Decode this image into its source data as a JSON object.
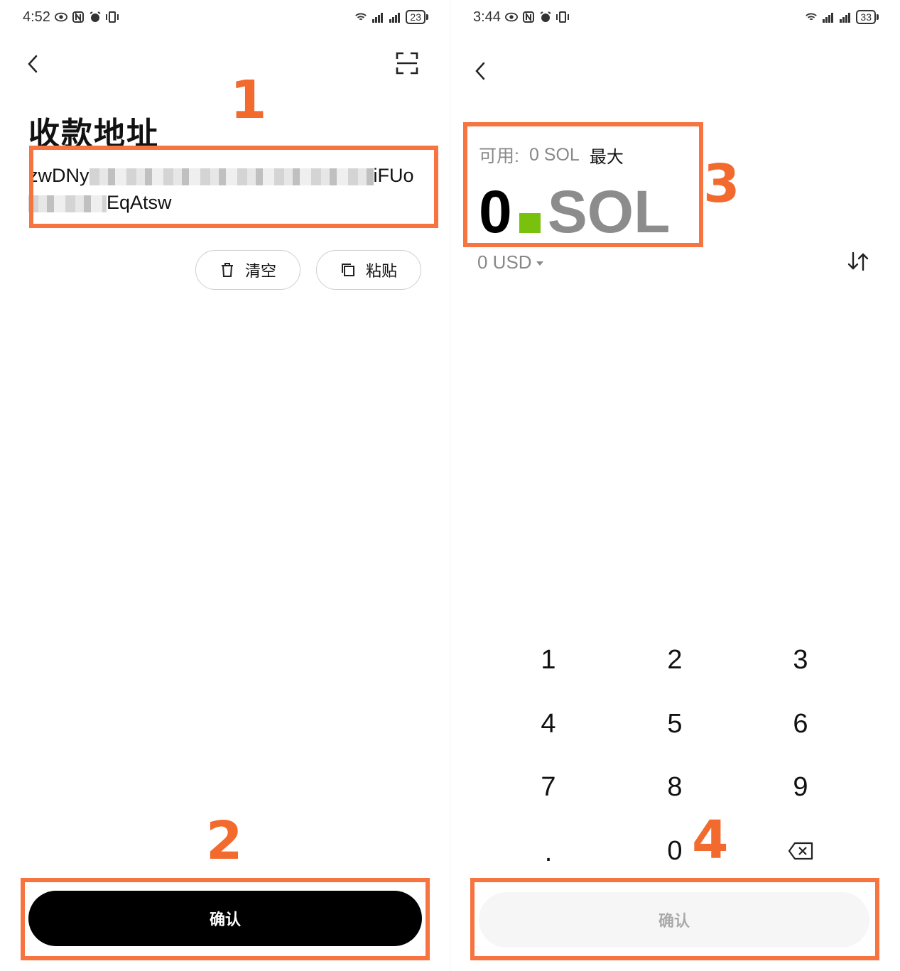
{
  "left": {
    "status": {
      "time": "4:52",
      "battery": "23"
    },
    "title": "收款地址",
    "address": {
      "line1_start": "zwDNy",
      "line1_end": "iFUo",
      "line2_end": "EqAtsw"
    },
    "buttons": {
      "clear": "清空",
      "paste": "粘贴"
    },
    "confirm": "确认"
  },
  "right": {
    "status": {
      "time": "3:44",
      "battery": "33"
    },
    "available_label": "可用:",
    "available_value": "0 SOL",
    "max": "最大",
    "amount_value": "0",
    "amount_unit": "SOL",
    "fiat": "0 USD",
    "keypad": [
      "1",
      "2",
      "3",
      "4",
      "5",
      "6",
      "7",
      "8",
      "9",
      ".",
      "0"
    ],
    "confirm": "确认"
  },
  "annotations": {
    "marks": [
      "1",
      "2",
      "3",
      "4"
    ],
    "color": "#f7733f"
  },
  "icons": [
    "back-icon",
    "scan-icon",
    "trash-icon",
    "copy-icon",
    "swap-icon",
    "backspace-icon",
    "wifi-icon",
    "signal-icon",
    "battery-icon"
  ]
}
